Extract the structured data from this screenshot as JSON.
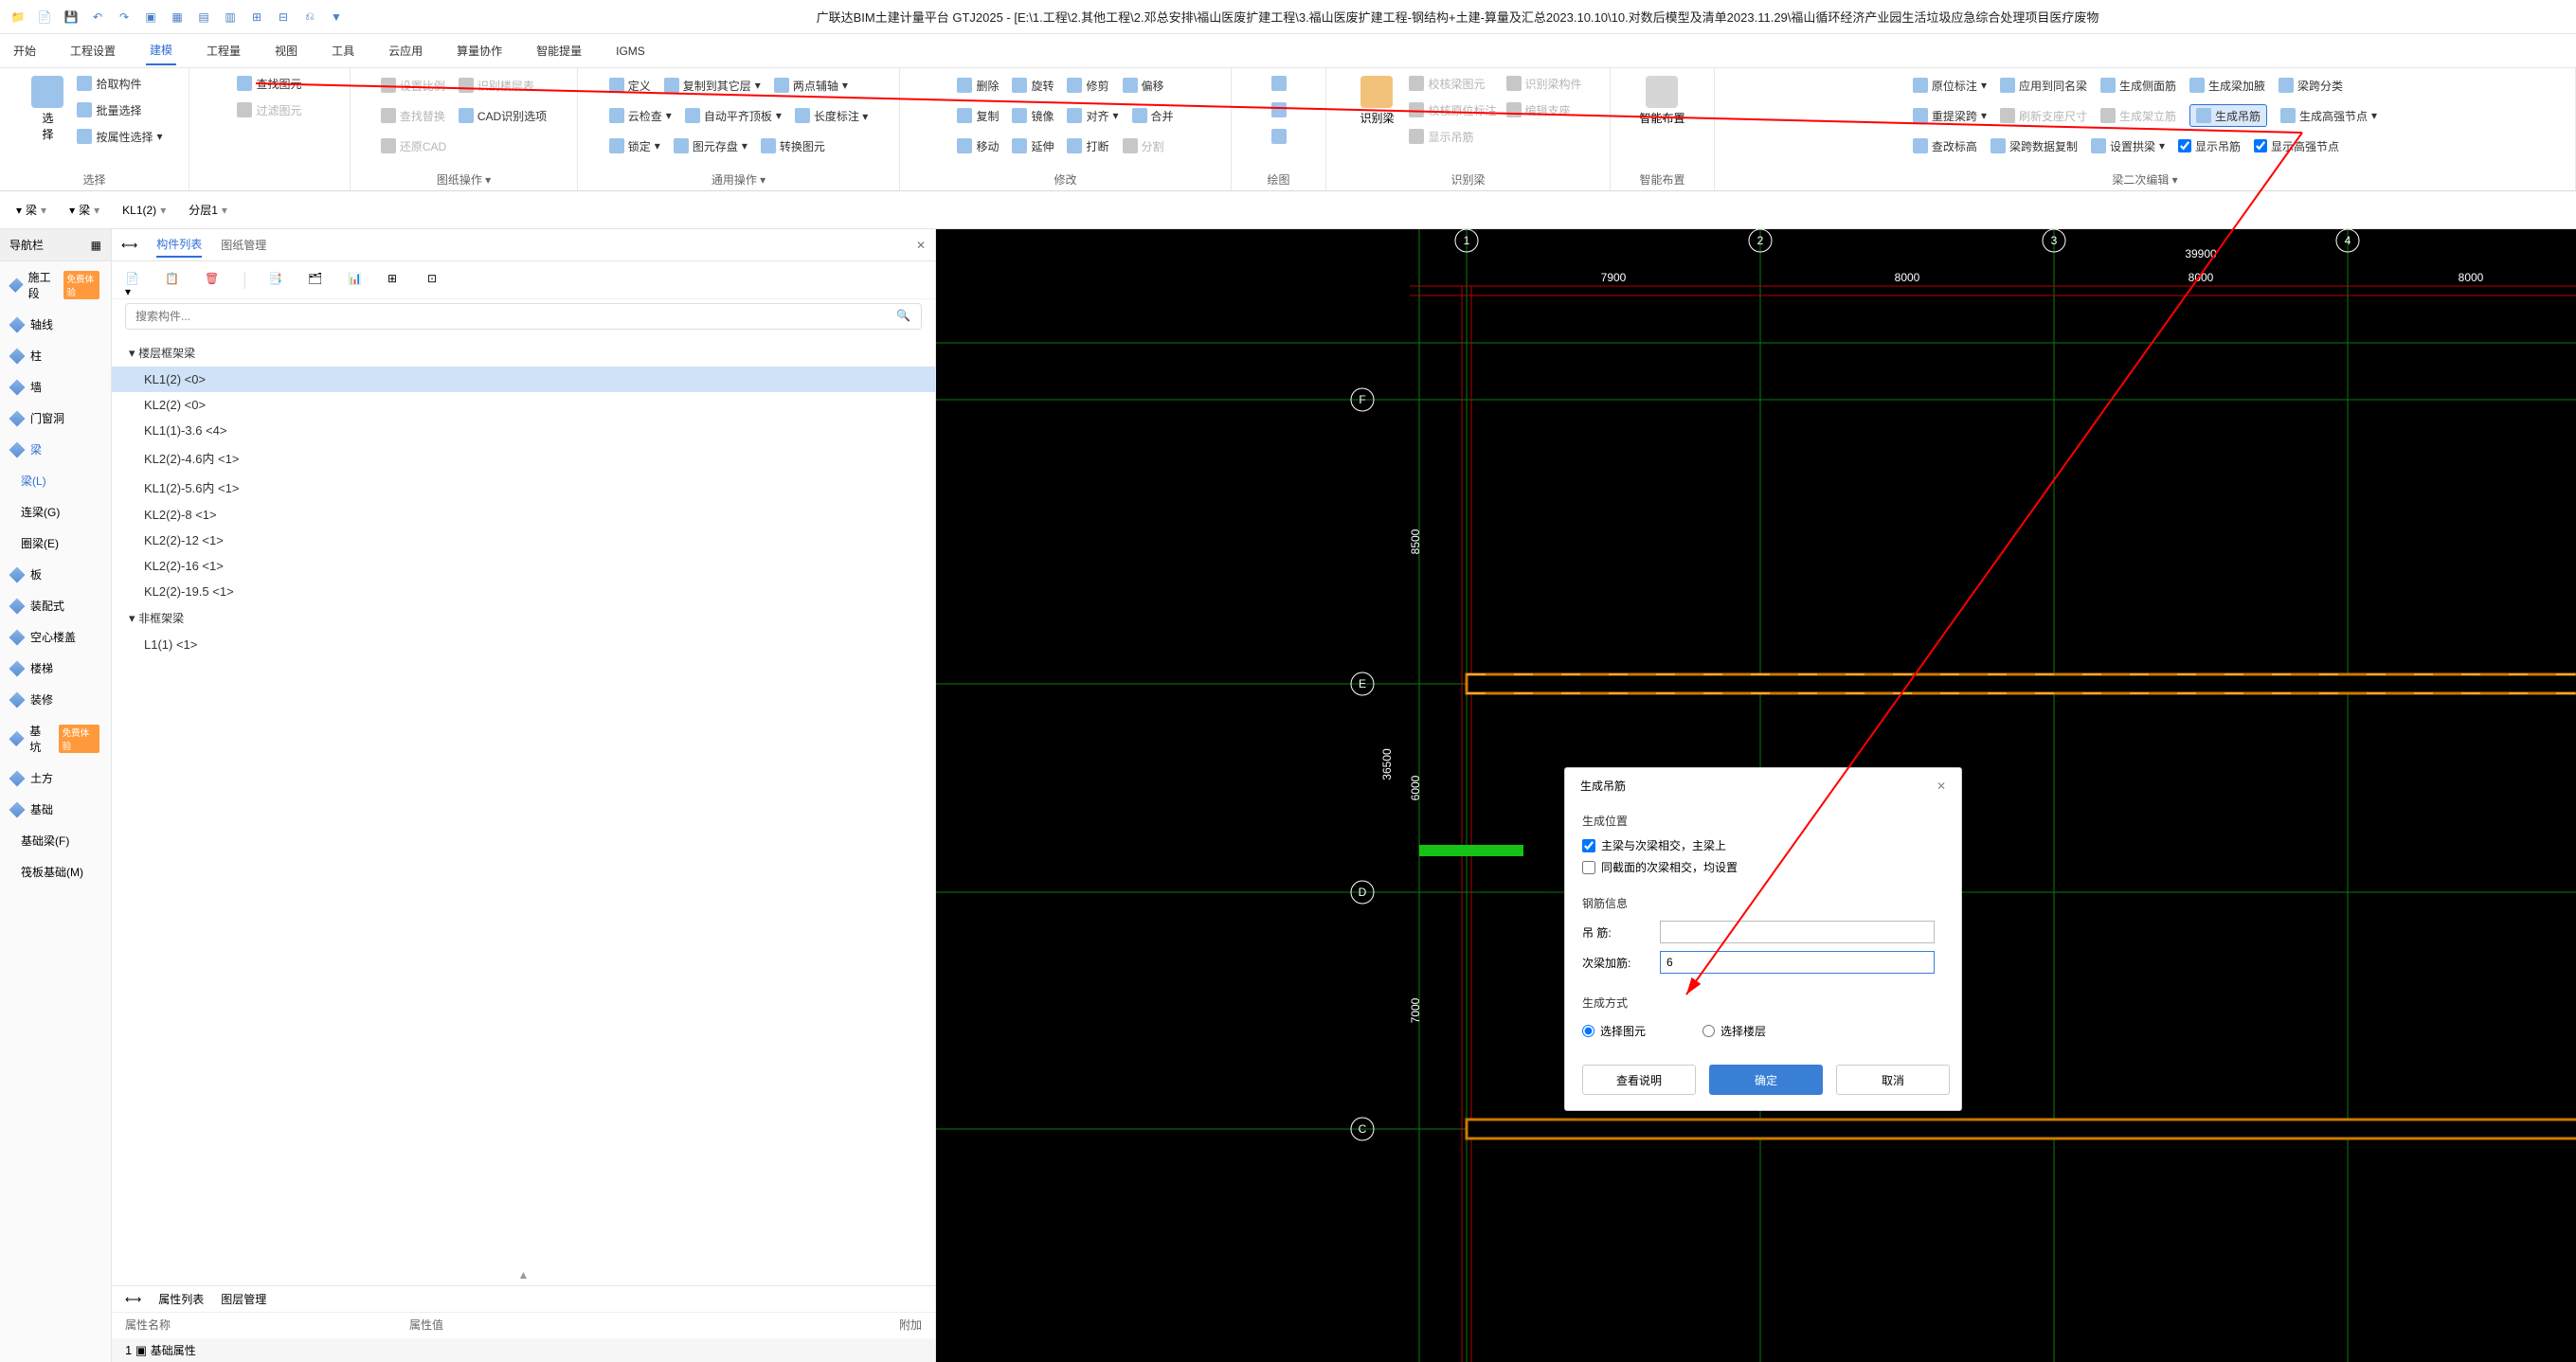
{
  "title": "广联达BIM土建计量平台 GTJ2025 - [E:\\1.工程\\2.其他工程\\2.邓总安排\\福山医废扩建工程\\3.福山医废扩建工程-钢结构+土建-算量及汇总2023.10.10\\10.对数后模型及清单2023.11.29\\福山循环经济产业园生活垃圾应急综合处理项目医疗废物",
  "menus": [
    "开始",
    "工程设置",
    "建模",
    "工程量",
    "视图",
    "工具",
    "云应用",
    "算量协作",
    "智能提量",
    "IGMS"
  ],
  "ribbon": {
    "g1": {
      "items": [
        "拾取构件",
        "批量选择",
        "按属性选择"
      ],
      "find": "查找图元",
      "filter": "过滤图元",
      "title": "选择"
    },
    "g2": {
      "items": [
        "设置比例",
        "识别楼层表",
        "查找替换",
        "CAD识别选项",
        "还原CAD"
      ],
      "title": "图纸操作"
    },
    "g3": {
      "items": [
        "定义",
        "云检查",
        "锁定",
        "复制到其它层",
        "自动平齐顶板",
        "图元存盘",
        "两点辅轴",
        "转换图元"
      ],
      "title": "通用操作"
    },
    "g4": {
      "items": [
        "删除",
        "复制",
        "移动",
        "旋转",
        "镜像",
        "延伸",
        "修剪",
        "对齐",
        "打断",
        "偏移",
        "合并",
        "分割"
      ],
      "title": "修改"
    },
    "g5": {
      "title": "绘图"
    },
    "g6": {
      "items": [
        "校核梁图元",
        "校核原位标注",
        "显示吊筋",
        "识别梁构件",
        "编辑支座"
      ],
      "big": "识别梁",
      "title": "识别梁"
    },
    "g7": {
      "big": "智能布置",
      "title": "智能布置"
    },
    "g8": {
      "items": [
        "原位标注",
        "重提梁跨",
        "查改标高",
        "应用到同名梁",
        "刷新支座尺寸",
        "梁跨数据复制",
        "生成侧面筋",
        "生成架立筋",
        "设置拱梁",
        "生成梁加腋",
        "生成吊筋",
        "显示吊筋",
        "梁跨分类",
        "生成高强节点",
        "显示高强节点"
      ],
      "title": "梁二次编辑"
    }
  },
  "highlighted_button": "生成吊筋",
  "filters": {
    "f1": "梁",
    "f2": "梁",
    "f3": "KL1(2)",
    "f4": "分层1"
  },
  "nav": {
    "header": "导航栏",
    "badge1": "免费体验",
    "badge2": "免费体验",
    "items": [
      "施工段",
      "轴线",
      "柱",
      "墙",
      "门窗洞",
      "梁",
      "梁(L)",
      "连梁(G)",
      "圈梁(E)",
      "板",
      "装配式",
      "空心楼盖",
      "楼梯",
      "装修",
      "基坑",
      "土方",
      "基础",
      "基础梁(F)",
      "筏板基础(M)"
    ]
  },
  "tree": {
    "tabs": [
      "构件列表",
      "图纸管理"
    ],
    "search_placeholder": "搜索构件...",
    "cat1": "楼层框架梁",
    "items": [
      "KL1(2)  <0>",
      "KL2(2)  <0>",
      "KL1(1)-3.6  <4>",
      "KL2(2)-4.6内  <1>",
      "KL1(2)-5.6内  <1>",
      "KL2(2)-8  <1>",
      "KL2(2)-12  <1>",
      "KL2(2)-16  <1>",
      "KL2(2)-19.5  <1>"
    ],
    "cat2": "非框架梁",
    "items2": [
      "L1(1)  <1>"
    ],
    "props_tabs": [
      "属性列表",
      "图层管理"
    ],
    "props_header": [
      "属性名称",
      "属性值",
      "附加"
    ],
    "basic": "基础属性"
  },
  "dialog": {
    "title": "生成吊筋",
    "sect1": "生成位置",
    "opt1": "主梁与次梁相交，主梁上",
    "opt2": "同截面的次梁相交，均设置",
    "sect2": "钢筋信息",
    "lab1": "吊 筋:",
    "lab2": "次梁加筋:",
    "val2": "6",
    "sect3": "生成方式",
    "radio1": "选择图元",
    "radio2": "选择楼层",
    "btn_info": "查看说明",
    "btn_ok": "确定",
    "btn_cancel": "取消"
  },
  "canvas": {
    "grids": [
      "1",
      "2",
      "3",
      "4"
    ],
    "rows": [
      "F",
      "E",
      "D",
      "C"
    ],
    "dims": [
      "7900",
      "8000",
      "8000",
      "8000"
    ],
    "total": "39900",
    "vdims": [
      "8500",
      "6000",
      "7000"
    ],
    "vtotal": "36500"
  }
}
